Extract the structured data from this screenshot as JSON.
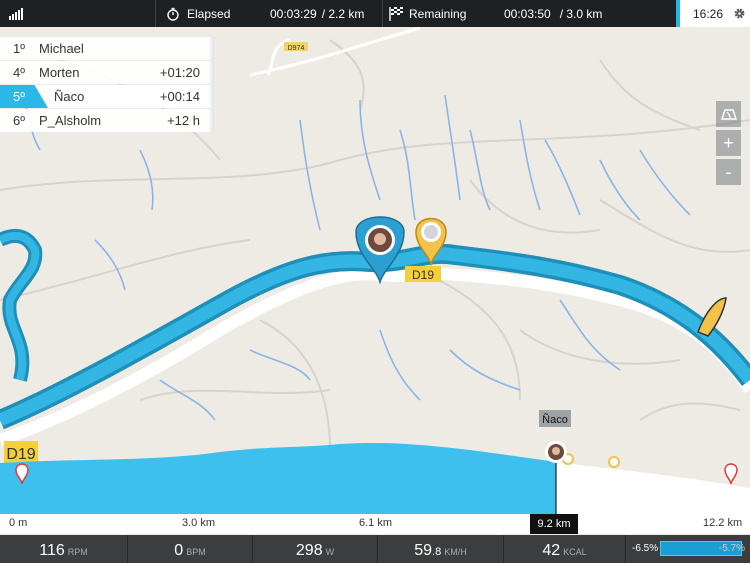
{
  "topbar": {
    "elapsed_label": "Elapsed",
    "elapsed_time": "00:03:29",
    "elapsed_distance": "/ 2.2 km",
    "remaining_label": "Remaining",
    "remaining_time": "00:03:50",
    "remaining_distance": "/ 3.0 km",
    "clock": "16:26"
  },
  "leaderboard": [
    {
      "position": "1º",
      "name": "Michael",
      "gap": ""
    },
    {
      "position": "4º",
      "name": "Morten",
      "gap": "+01:20"
    },
    {
      "position": "5º",
      "name": "Ñaco",
      "gap": "+00:14",
      "is_current": true
    },
    {
      "position": "6º",
      "name": "P_Alsholm",
      "gap": "+12 h"
    }
  ],
  "map": {
    "road_labels": [
      "D974",
      "D19",
      "D19"
    ],
    "rider_marker_label": "Ñaco",
    "route_color": "#2fb3e3",
    "progress_color": "#3ec0ee"
  },
  "map_controls": {
    "map_mode_icon": "map-layers-icon",
    "zoom_in": "+",
    "zoom_out": "-"
  },
  "distance_axis": {
    "ticks": [
      "0 m",
      "3.0 km",
      "6.1 km",
      "12.2 km"
    ],
    "current": "9.2 km",
    "total_km": 12.2,
    "current_km": 9.2
  },
  "stats": {
    "cadence": {
      "value": "116",
      "unit": "RPM"
    },
    "heart_rate": {
      "value": "0",
      "unit": "BPM"
    },
    "power": {
      "value": "298",
      "unit": "W"
    },
    "speed": {
      "value_int": "59",
      "value_dec": ".8",
      "unit": "KM/H"
    },
    "calories": {
      "value": "42",
      "unit": "KCAL"
    },
    "grade_current": "-6.5%",
    "grade_next": "-5.7%"
  }
}
